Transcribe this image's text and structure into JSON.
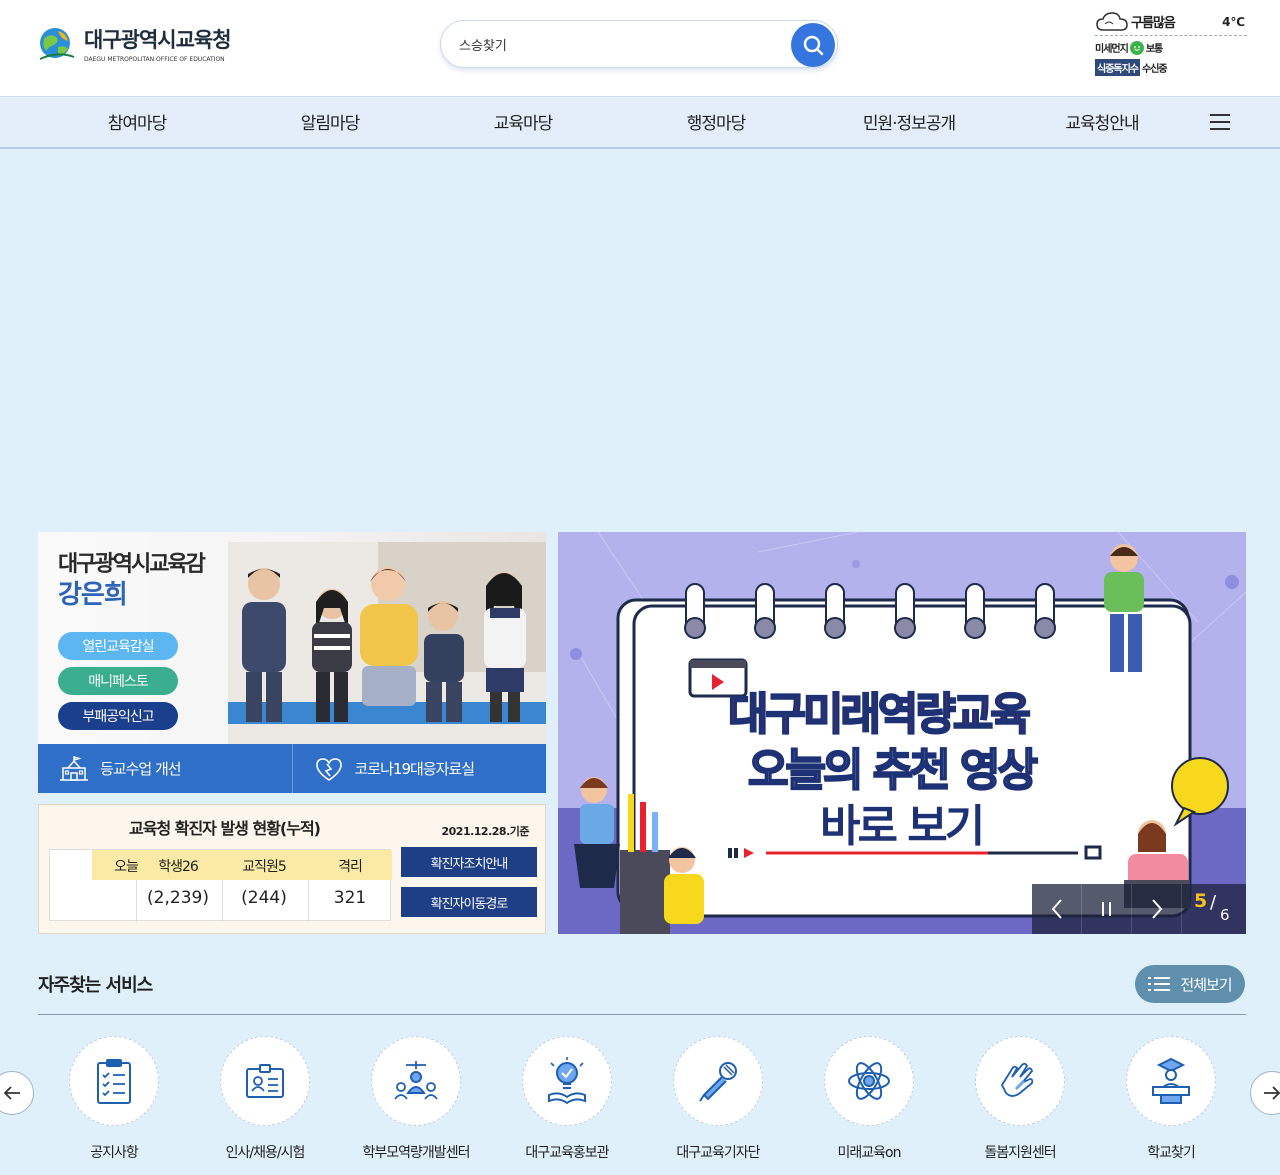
{
  "header": {
    "logo_title": "대구광역시교육청",
    "logo_subtitle": "DAEGU METROPOLITAN OFFICE OF EDUCATION",
    "search_value": "스승찾기"
  },
  "weather": {
    "condition": "구름많음",
    "temperature": "4℃",
    "fine_dust_label": "미세먼지",
    "fine_dust_value": "보통",
    "food_index_label": "식중독지수",
    "food_index_value": "수신중"
  },
  "nav": {
    "items": [
      "참여마당",
      "알림마당",
      "교육마당",
      "행정마당",
      "민원·정보공개",
      "교육청안내"
    ]
  },
  "superintendent": {
    "title": "대구광역시교육감",
    "name": "강은희",
    "buttons": [
      {
        "label": "열린교육감실",
        "color": "#5cb6f2"
      },
      {
        "label": "매니페스토",
        "color": "#3aae8f"
      },
      {
        "label": "부패공익신고",
        "color": "#1b3f8c"
      }
    ]
  },
  "quick_links": [
    {
      "label": "등교수업 개선",
      "icon": "school-icon"
    },
    {
      "label": "코로나19대응자료실",
      "icon": "heart-shield-icon"
    }
  ],
  "covid": {
    "title": "교육청 확진자 발생 현황(누적)",
    "date": "2021.12.28.기준",
    "today_label": "오늘",
    "columns": [
      "학생26",
      "교직원5",
      "격리"
    ],
    "values": [
      "(2,239)",
      "(244)",
      "321"
    ],
    "buttons": [
      "확진자조치안내",
      "확진자이동경로"
    ]
  },
  "banner": {
    "line1": "대구미래역량교육",
    "line2": "오늘의 추천 영상",
    "line3": "바로 보기",
    "current_page": "5",
    "total_pages": "6"
  },
  "services": {
    "title": "자주찾는 서비스",
    "view_all": "전체보기",
    "items": [
      {
        "label": "공지사항",
        "icon": "clipboard-checklist-icon"
      },
      {
        "label": "인사/채용/시험",
        "icon": "id-card-icon"
      },
      {
        "label": "학부모역량개발센터",
        "icon": "family-icon"
      },
      {
        "label": "대구교육홍보관",
        "icon": "lightbulb-book-icon"
      },
      {
        "label": "대구교육기자단",
        "icon": "microphone-icon"
      },
      {
        "label": "미래교육on",
        "icon": "atom-icon"
      },
      {
        "label": "돌봄지원센터",
        "icon": "hands-icon"
      },
      {
        "label": "학교찾기",
        "icon": "graduate-podium-icon"
      }
    ]
  }
}
